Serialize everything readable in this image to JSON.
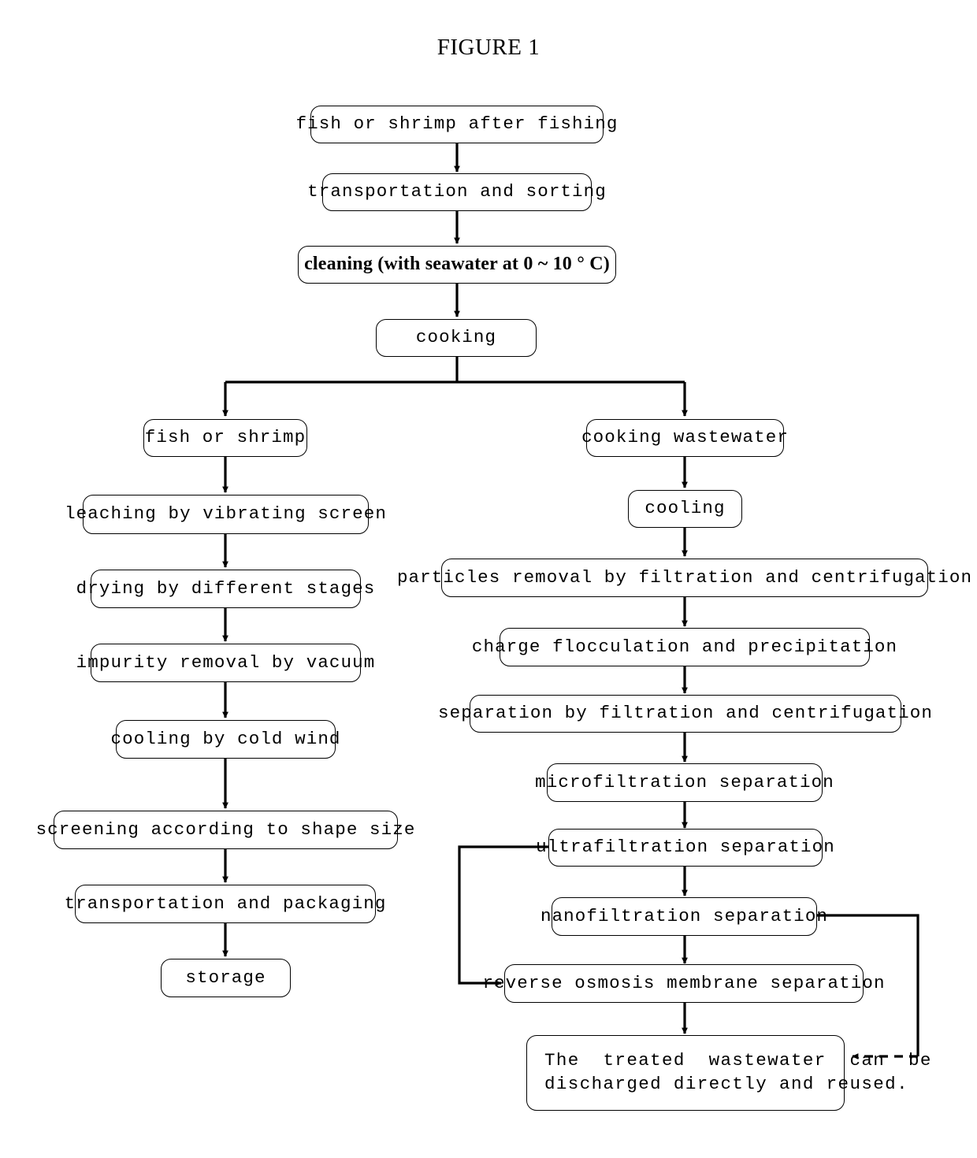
{
  "figure": {
    "title": "FIGURE 1"
  },
  "colors": {
    "line": "#000000",
    "box_border": "#000000",
    "background": "#ffffff",
    "text": "#000000"
  },
  "diagram": {
    "type": "flowchart",
    "orientation": "top-to-bottom",
    "nodes": [
      {
        "id": "n1",
        "label": "fish or shrimp after fishing",
        "style": "mono",
        "column": "main"
      },
      {
        "id": "n2",
        "label": "transportation and sorting",
        "style": "mono",
        "column": "main"
      },
      {
        "id": "n3",
        "label": "cleaning (with seawater at 0 ~ 10 ° C)",
        "style": "serif-bold",
        "column": "main"
      },
      {
        "id": "n4",
        "label": "cooking",
        "style": "mono",
        "column": "main"
      },
      {
        "id": "l1",
        "label": "fish or shrimp",
        "style": "mono",
        "column": "left"
      },
      {
        "id": "l2",
        "label": "leaching by vibrating screen",
        "style": "mono",
        "column": "left"
      },
      {
        "id": "l3",
        "label": "drying by different stages",
        "style": "mono",
        "column": "left"
      },
      {
        "id": "l4",
        "label": "impurity removal by vacuum",
        "style": "mono",
        "column": "left"
      },
      {
        "id": "l5",
        "label": "cooling by cold wind",
        "style": "mono",
        "column": "left"
      },
      {
        "id": "l6",
        "label": "screening according to shape size",
        "style": "mono",
        "column": "left"
      },
      {
        "id": "l7",
        "label": "transportation and packaging",
        "style": "mono",
        "column": "left"
      },
      {
        "id": "l8",
        "label": "storage",
        "style": "mono",
        "column": "left"
      },
      {
        "id": "r1",
        "label": "cooking wastewater",
        "style": "mono",
        "column": "right"
      },
      {
        "id": "r2",
        "label": "cooling",
        "style": "mono",
        "column": "right"
      },
      {
        "id": "r3",
        "label": "particles removal by filtration and centrifugation",
        "style": "mono",
        "column": "right"
      },
      {
        "id": "r4",
        "label": "charge flocculation and precipitation",
        "style": "mono",
        "column": "right"
      },
      {
        "id": "r5",
        "label": "separation by filtration and centrifugation",
        "style": "mono",
        "column": "right"
      },
      {
        "id": "r6",
        "label": "microfiltration separation",
        "style": "mono",
        "column": "right"
      },
      {
        "id": "r7",
        "label": "ultrafiltration separation",
        "style": "mono",
        "column": "right"
      },
      {
        "id": "r8",
        "label": "nanofiltration separation",
        "style": "mono",
        "column": "right"
      },
      {
        "id": "r9",
        "label": "reverse osmosis membrane separation",
        "style": "mono",
        "column": "right"
      },
      {
        "id": "r10",
        "label_line1": "The  treated  wastewater  can  be",
        "label_line2": "discharged directly and reused.",
        "style": "mono",
        "column": "right"
      }
    ],
    "edges": [
      {
        "from": "n1",
        "to": "n2",
        "kind": "solid",
        "shape": "straight-down"
      },
      {
        "from": "n2",
        "to": "n3",
        "kind": "solid",
        "shape": "straight-down"
      },
      {
        "from": "n3",
        "to": "n4",
        "kind": "solid",
        "shape": "straight-down"
      },
      {
        "from": "n4",
        "to": "l1",
        "kind": "solid",
        "shape": "split-left"
      },
      {
        "from": "n4",
        "to": "r1",
        "kind": "solid",
        "shape": "split-right"
      },
      {
        "from": "l1",
        "to": "l2",
        "kind": "solid",
        "shape": "straight-down"
      },
      {
        "from": "l2",
        "to": "l3",
        "kind": "solid",
        "shape": "straight-down"
      },
      {
        "from": "l3",
        "to": "l4",
        "kind": "solid",
        "shape": "straight-down"
      },
      {
        "from": "l4",
        "to": "l5",
        "kind": "solid",
        "shape": "straight-down"
      },
      {
        "from": "l5",
        "to": "l6",
        "kind": "solid",
        "shape": "straight-down"
      },
      {
        "from": "l6",
        "to": "l7",
        "kind": "solid",
        "shape": "straight-down"
      },
      {
        "from": "l7",
        "to": "l8",
        "kind": "solid",
        "shape": "straight-down"
      },
      {
        "from": "r1",
        "to": "r2",
        "kind": "solid",
        "shape": "straight-down"
      },
      {
        "from": "r2",
        "to": "r3",
        "kind": "solid",
        "shape": "straight-down"
      },
      {
        "from": "r3",
        "to": "r4",
        "kind": "solid",
        "shape": "straight-down"
      },
      {
        "from": "r4",
        "to": "r5",
        "kind": "solid",
        "shape": "straight-down"
      },
      {
        "from": "r5",
        "to": "r6",
        "kind": "solid",
        "shape": "straight-down"
      },
      {
        "from": "r6",
        "to": "r7",
        "kind": "solid",
        "shape": "straight-down"
      },
      {
        "from": "r7",
        "to": "r8",
        "kind": "solid",
        "shape": "straight-down"
      },
      {
        "from": "r8",
        "to": "r9",
        "kind": "solid",
        "shape": "straight-down"
      },
      {
        "from": "r9",
        "to": "r10",
        "kind": "solid",
        "shape": "straight-down"
      },
      {
        "from": "r7",
        "to": "r9",
        "kind": "solid",
        "shape": "bypass-left"
      },
      {
        "from": "r8",
        "to": "r10",
        "kind": "dashed",
        "shape": "bypass-right"
      }
    ]
  }
}
